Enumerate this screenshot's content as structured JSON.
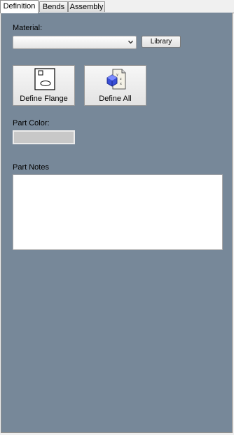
{
  "tabs": [
    {
      "label": "Definition",
      "active": true
    },
    {
      "label": "Bends",
      "active": false
    },
    {
      "label": "Assembly",
      "active": false
    }
  ],
  "material": {
    "label": "Material:",
    "value": "",
    "library_button": "Library"
  },
  "actions": [
    {
      "label": "Define Flange",
      "icon": "flange-icon"
    },
    {
      "label": "Define All",
      "icon": "define-all-icon"
    }
  ],
  "part_color": {
    "label": "Part Color:",
    "color": "#c8c8c8"
  },
  "part_notes": {
    "label": "Part Notes",
    "value": ""
  },
  "colors": {
    "panel": "#778899",
    "tab_active": "#ffffff"
  }
}
